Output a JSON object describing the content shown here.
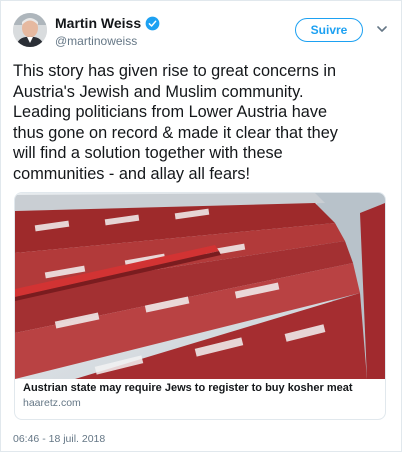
{
  "author": {
    "display_name": "Martin Weiss",
    "handle": "@martinoweiss",
    "verified": true
  },
  "actions": {
    "follow_label": "Suivre",
    "more_icon": "chevron-down-icon"
  },
  "tweet": {
    "lines": [
      "This story has given rise to great concerns in",
      "Austria's Jewish and Muslim community.",
      "Leading politicians from Lower Austria have",
      "thus gone on record & made it clear that they",
      "will find a solution together with these",
      "communities - and allay all fears!"
    ],
    "timestamp": "06:46 - 18 juil. 2018"
  },
  "link_card": {
    "title": "Austrian state may require Jews to register to buy kosher meat",
    "domain": "haaretz.com"
  },
  "colors": {
    "accent": "#1da1f2",
    "secondary_text": "#657786",
    "border": "#e1e8ed"
  }
}
